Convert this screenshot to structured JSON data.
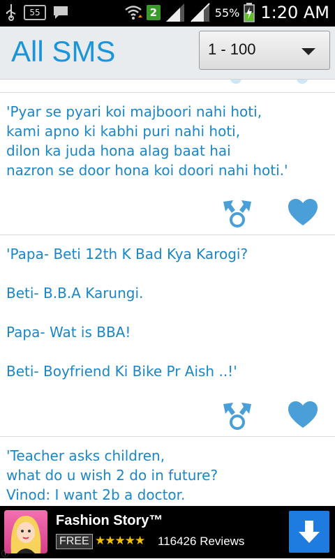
{
  "status_bar": {
    "notification_count": "55",
    "sim_badge": "2",
    "battery": "55%",
    "time": "1:20 AM"
  },
  "header": {
    "title": "All SMS",
    "range": "1 - 100"
  },
  "messages": [
    {
      "text": "'Pyar se pyari koi majboori nahi hoti,\nkami apno ki kabhi puri nahi hoti,\ndilon ka juda hona alag baat hai\nnazron se door hona koi doori nahi hoti.'"
    },
    {
      "text": "'Papa- Beti 12th K Bad Kya Karogi?\n\nBeti- B.B.A Karungi.\n\nPapa- Wat is BBA!\n\nBeti- Boyfriend Ki Bike Pr Aish ..!'"
    },
    {
      "text": "'Teacher asks children,\nwhat do u wish 2 do in future?\nVinod: I want 2b a doctor."
    }
  ],
  "ad": {
    "title": "Fashion Story™",
    "price": "FREE",
    "stars": "★★★★★",
    "reviews": "116426 Reviews"
  },
  "colors": {
    "accent": "#1b94d8",
    "text": "#1b86c6",
    "icon": "#4a9fd8"
  }
}
